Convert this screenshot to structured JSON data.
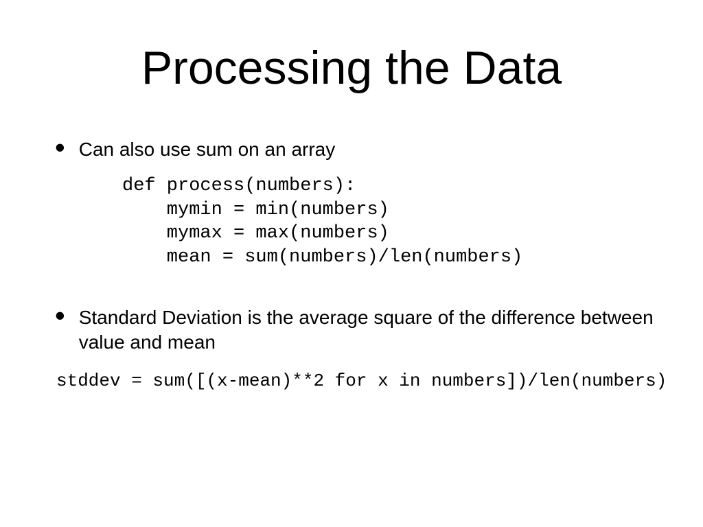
{
  "title": "Processing the Data",
  "bullets": {
    "b1": "Can also use sum on an array",
    "b2": "Standard Deviation is the average square of the difference between value and mean"
  },
  "code1": "def process(numbers):\n    mymin = min(numbers)\n    mymax = max(numbers)\n    mean = sum(numbers)/len(numbers)",
  "code2": "stddev = sum([(x-mean)**2 for x in numbers])/len(numbers)"
}
